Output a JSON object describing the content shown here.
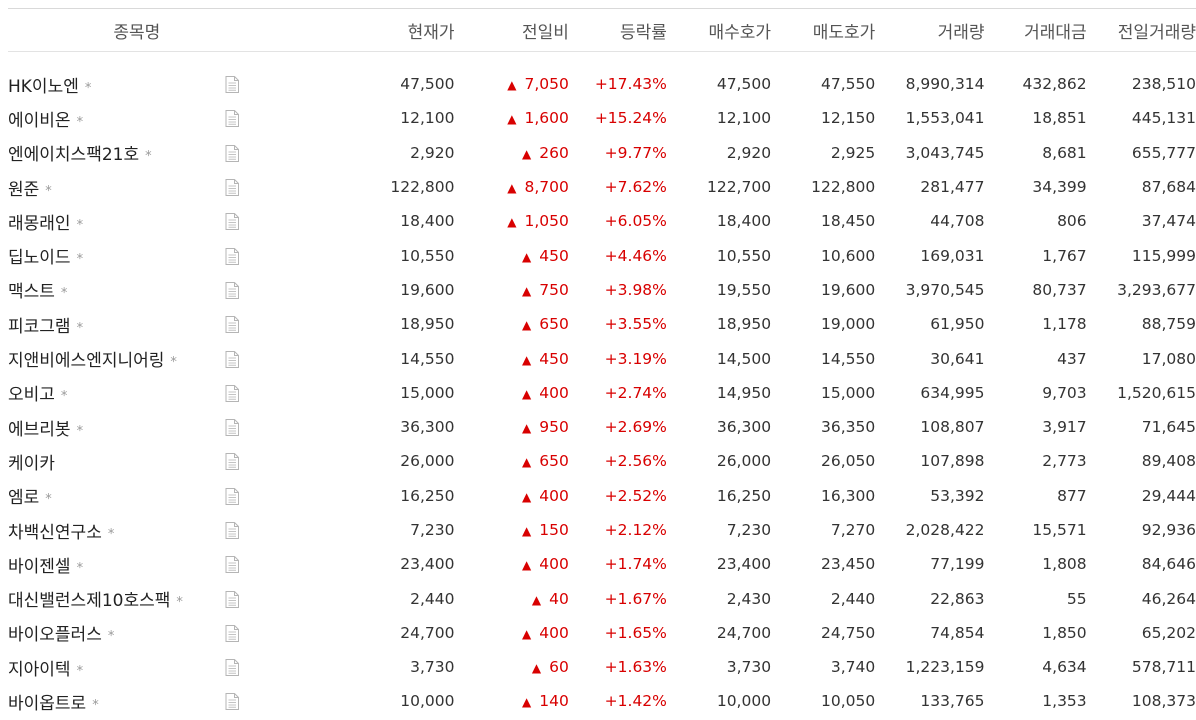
{
  "headers": {
    "name": "종목명",
    "price": "현재가",
    "change": "전일비",
    "rate": "등락률",
    "bid": "매수호가",
    "ask": "매도호가",
    "volume": "거래량",
    "amount": "거래대금",
    "prev_volume": "전일거래량"
  },
  "colors": {
    "up": "#d80000"
  },
  "rows": [
    {
      "name": "HK이노엔",
      "star": "*",
      "price": "47,500",
      "change": "7,050",
      "rate": "+17.43%",
      "bid": "47,500",
      "ask": "47,550",
      "volume": "8,990,314",
      "amount": "432,862",
      "prev_volume": "238,510"
    },
    {
      "name": "에이비온",
      "star": "*",
      "price": "12,100",
      "change": "1,600",
      "rate": "+15.24%",
      "bid": "12,100",
      "ask": "12,150",
      "volume": "1,553,041",
      "amount": "18,851",
      "prev_volume": "445,131"
    },
    {
      "name": "엔에이치스팩21호",
      "star": "*",
      "price": "2,920",
      "change": "260",
      "rate": "+9.77%",
      "bid": "2,920",
      "ask": "2,925",
      "volume": "3,043,745",
      "amount": "8,681",
      "prev_volume": "655,777"
    },
    {
      "name": "원준",
      "star": "*",
      "price": "122,800",
      "change": "8,700",
      "rate": "+7.62%",
      "bid": "122,700",
      "ask": "122,800",
      "volume": "281,477",
      "amount": "34,399",
      "prev_volume": "87,684"
    },
    {
      "name": "래몽래인",
      "star": "*",
      "price": "18,400",
      "change": "1,050",
      "rate": "+6.05%",
      "bid": "18,400",
      "ask": "18,450",
      "volume": "44,708",
      "amount": "806",
      "prev_volume": "37,474"
    },
    {
      "name": "딥노이드",
      "star": "*",
      "price": "10,550",
      "change": "450",
      "rate": "+4.46%",
      "bid": "10,550",
      "ask": "10,600",
      "volume": "169,031",
      "amount": "1,767",
      "prev_volume": "115,999"
    },
    {
      "name": "맥스트",
      "star": "*",
      "price": "19,600",
      "change": "750",
      "rate": "+3.98%",
      "bid": "19,550",
      "ask": "19,600",
      "volume": "3,970,545",
      "amount": "80,737",
      "prev_volume": "3,293,677"
    },
    {
      "name": "피코그램",
      "star": "*",
      "price": "18,950",
      "change": "650",
      "rate": "+3.55%",
      "bid": "18,950",
      "ask": "19,000",
      "volume": "61,950",
      "amount": "1,178",
      "prev_volume": "88,759"
    },
    {
      "name": "지앤비에스엔지니어링",
      "star": "*",
      "price": "14,550",
      "change": "450",
      "rate": "+3.19%",
      "bid": "14,500",
      "ask": "14,550",
      "volume": "30,641",
      "amount": "437",
      "prev_volume": "17,080"
    },
    {
      "name": "오비고",
      "star": "*",
      "price": "15,000",
      "change": "400",
      "rate": "+2.74%",
      "bid": "14,950",
      "ask": "15,000",
      "volume": "634,995",
      "amount": "9,703",
      "prev_volume": "1,520,615"
    },
    {
      "name": "에브리봇",
      "star": "*",
      "price": "36,300",
      "change": "950",
      "rate": "+2.69%",
      "bid": "36,300",
      "ask": "36,350",
      "volume": "108,807",
      "amount": "3,917",
      "prev_volume": "71,645"
    },
    {
      "name": "케이카",
      "star": "",
      "price": "26,000",
      "change": "650",
      "rate": "+2.56%",
      "bid": "26,000",
      "ask": "26,050",
      "volume": "107,898",
      "amount": "2,773",
      "prev_volume": "89,408"
    },
    {
      "name": "엠로",
      "star": "*",
      "price": "16,250",
      "change": "400",
      "rate": "+2.52%",
      "bid": "16,250",
      "ask": "16,300",
      "volume": "53,392",
      "amount": "877",
      "prev_volume": "29,444"
    },
    {
      "name": "차백신연구소",
      "star": "*",
      "price": "7,230",
      "change": "150",
      "rate": "+2.12%",
      "bid": "7,230",
      "ask": "7,270",
      "volume": "2,028,422",
      "amount": "15,571",
      "prev_volume": "92,936"
    },
    {
      "name": "바이젠셀",
      "star": "*",
      "price": "23,400",
      "change": "400",
      "rate": "+1.74%",
      "bid": "23,400",
      "ask": "23,450",
      "volume": "77,199",
      "amount": "1,808",
      "prev_volume": "84,646"
    },
    {
      "name": "대신밸런스제10호스팩",
      "star": "*",
      "price": "2,440",
      "change": "40",
      "rate": "+1.67%",
      "bid": "2,430",
      "ask": "2,440",
      "volume": "22,863",
      "amount": "55",
      "prev_volume": "46,264"
    },
    {
      "name": "바이오플러스",
      "star": "*",
      "price": "24,700",
      "change": "400",
      "rate": "+1.65%",
      "bid": "24,700",
      "ask": "24,750",
      "volume": "74,854",
      "amount": "1,850",
      "prev_volume": "65,202"
    },
    {
      "name": "지아이텍",
      "star": "*",
      "price": "3,730",
      "change": "60",
      "rate": "+1.63%",
      "bid": "3,730",
      "ask": "3,740",
      "volume": "1,223,159",
      "amount": "4,634",
      "prev_volume": "578,711"
    },
    {
      "name": "바이옵트로",
      "star": "*",
      "price": "10,000",
      "change": "140",
      "rate": "+1.42%",
      "bid": "10,000",
      "ask": "10,050",
      "volume": "133,765",
      "amount": "1,353",
      "prev_volume": "108,373"
    }
  ]
}
